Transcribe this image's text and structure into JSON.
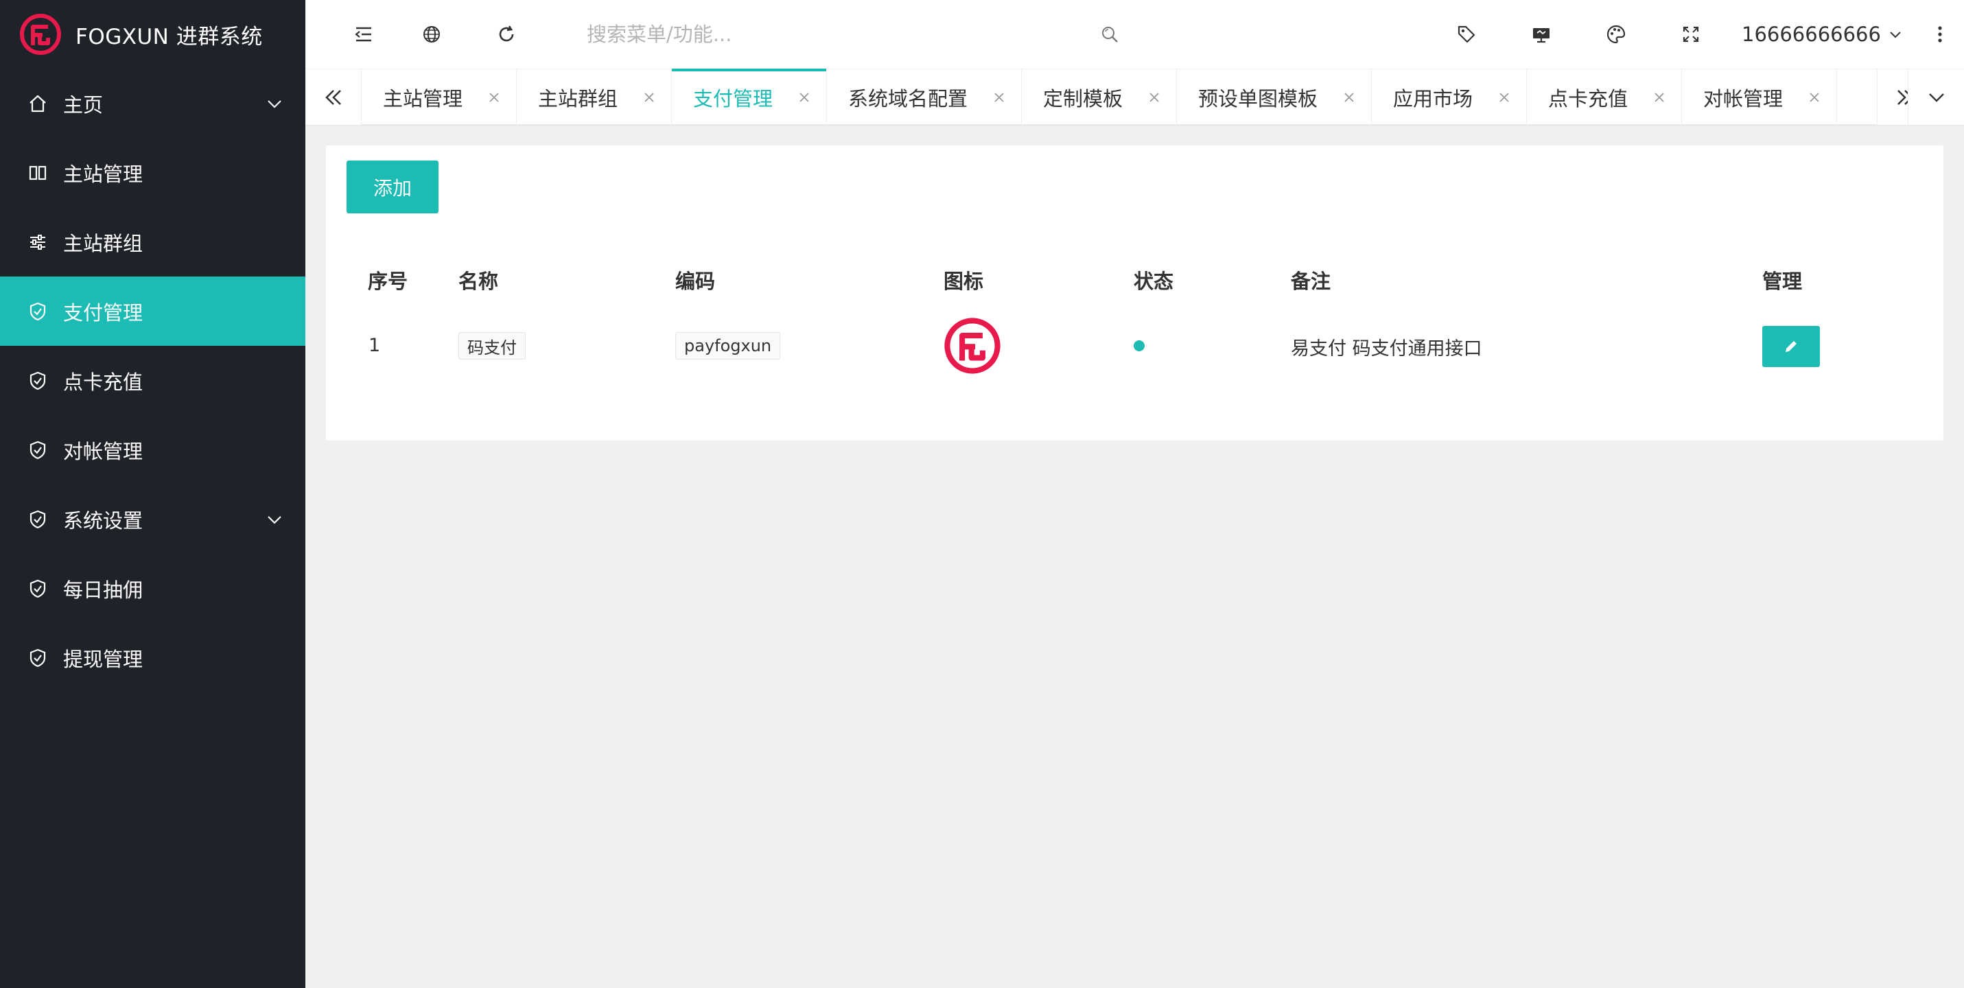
{
  "brand": {
    "name": "FOGXUN 进群系统",
    "accent": "#1cbbb4",
    "logo_color": "#e8194b"
  },
  "sidebar": {
    "items": [
      {
        "label": "主页",
        "icon": "home-icon",
        "expandable": true
      },
      {
        "label": "主站管理",
        "icon": "columns-icon"
      },
      {
        "label": "主站群组",
        "icon": "sliders-icon"
      },
      {
        "label": "支付管理",
        "icon": "shield-icon",
        "active": true
      },
      {
        "label": "点卡充值",
        "icon": "shield-icon"
      },
      {
        "label": "对帐管理",
        "icon": "shield-icon"
      },
      {
        "label": "系统设置",
        "icon": "shield-icon",
        "expandable": true
      },
      {
        "label": "每日抽佣",
        "icon": "shield-icon"
      },
      {
        "label": "提现管理",
        "icon": "shield-icon"
      }
    ]
  },
  "header": {
    "search_placeholder": "搜索菜单/功能...",
    "user": "16666666666",
    "icons": [
      "menu-collapse-icon",
      "globe-icon",
      "refresh-icon",
      "search-icon",
      "tag-icon",
      "monitor-icon",
      "palette-icon",
      "fullscreen-icon",
      "more-vertical-icon"
    ]
  },
  "tabs": [
    {
      "label": "主站管理"
    },
    {
      "label": "主站群组"
    },
    {
      "label": "支付管理",
      "active": true
    },
    {
      "label": "系统域名配置"
    },
    {
      "label": "定制模板"
    },
    {
      "label": "预设单图模板"
    },
    {
      "label": "应用市场"
    },
    {
      "label": "点卡充值"
    },
    {
      "label": "对帐管理"
    }
  ],
  "main": {
    "add_label": "添加",
    "columns": [
      "序号",
      "名称",
      "编码",
      "图标",
      "状态",
      "备注",
      "管理"
    ],
    "rows": [
      {
        "index": "1",
        "name": "码支付",
        "code": "payfogxun",
        "icon": "fogxun-logo-icon",
        "status": "enabled",
        "remark": "易支付 码支付通用接口"
      }
    ]
  }
}
